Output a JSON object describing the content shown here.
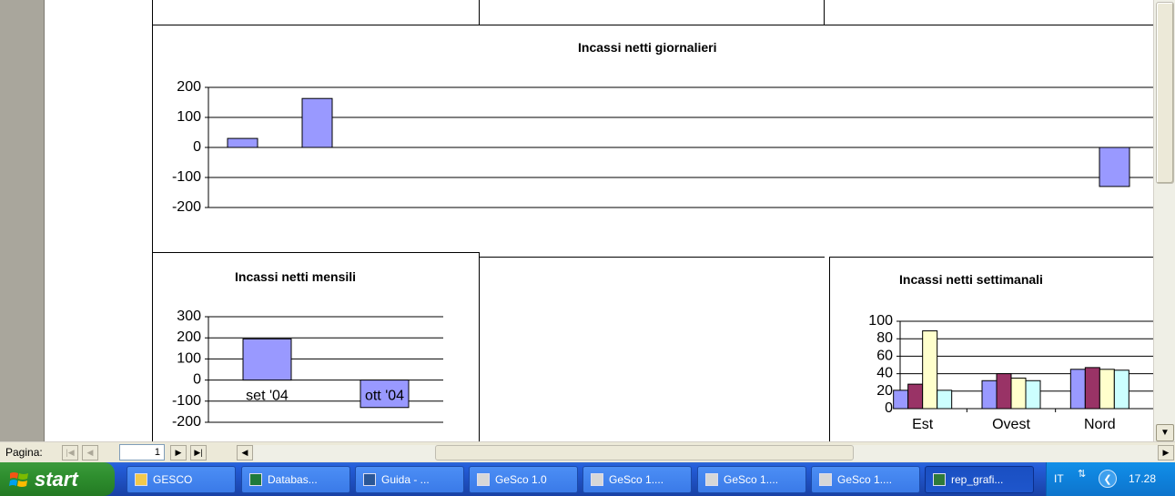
{
  "report": {
    "chart_daily": {
      "title": "Incassi netti giornalieri"
    },
    "chart_monthly": {
      "title": "Incassi netti mensili"
    },
    "chart_weekly": {
      "title": "Incassi netti settimanali"
    }
  },
  "chart_data": [
    {
      "type": "bar",
      "title": "Incassi netti giornalieri",
      "ylim": [
        -200,
        200
      ],
      "yticks": [
        "200",
        "100",
        "0",
        "-100",
        "-200"
      ],
      "series": [
        {
          "values": [
            30,
            163,
            -130
          ]
        }
      ],
      "color": "#9999ff"
    },
    {
      "type": "bar",
      "title": "Incassi netti mensili",
      "ylim": [
        -200,
        300
      ],
      "yticks": [
        "300",
        "200",
        "100",
        "0",
        "-100",
        "-200"
      ],
      "categories": [
        "set '04",
        "ott '04"
      ],
      "series": [
        {
          "values": [
            195,
            -130
          ]
        }
      ],
      "color": "#9999ff"
    },
    {
      "type": "bar",
      "title": "Incassi netti settimanali",
      "ylim": [
        0,
        100
      ],
      "yticks": [
        "100",
        "80",
        "60",
        "40",
        "20",
        "0"
      ],
      "categories": [
        "Est",
        "Ovest",
        "Nord"
      ],
      "series": [
        {
          "values": [
            21,
            32,
            45
          ],
          "color": "#9999ff"
        },
        {
          "values": [
            28,
            40,
            47
          ],
          "color": "#993366"
        },
        {
          "values": [
            89,
            35,
            45
          ],
          "color": "#ffffcc"
        },
        {
          "values": [
            21,
            32,
            44
          ],
          "color": "#ccffff"
        }
      ]
    }
  ],
  "navigation": {
    "label": "Pagina:",
    "page_value": "1"
  },
  "taskbar": {
    "start_label": "start",
    "tasks": [
      {
        "label": "GESCO",
        "icon": "folder-icon"
      },
      {
        "label": "Databas...",
        "icon": "excel-icon"
      },
      {
        "label": "Guida - ...",
        "icon": "word-icon"
      },
      {
        "label": "GeSco 1.0",
        "icon": "form-icon"
      },
      {
        "label": "GeSco 1....",
        "icon": "form-icon"
      },
      {
        "label": "GeSco 1....",
        "icon": "form-icon"
      },
      {
        "label": "GeSco 1....",
        "icon": "form-icon"
      },
      {
        "label": "rep_grafi...",
        "icon": "report-icon"
      }
    ],
    "tray": {
      "language": "IT",
      "clock": "17.28"
    }
  }
}
